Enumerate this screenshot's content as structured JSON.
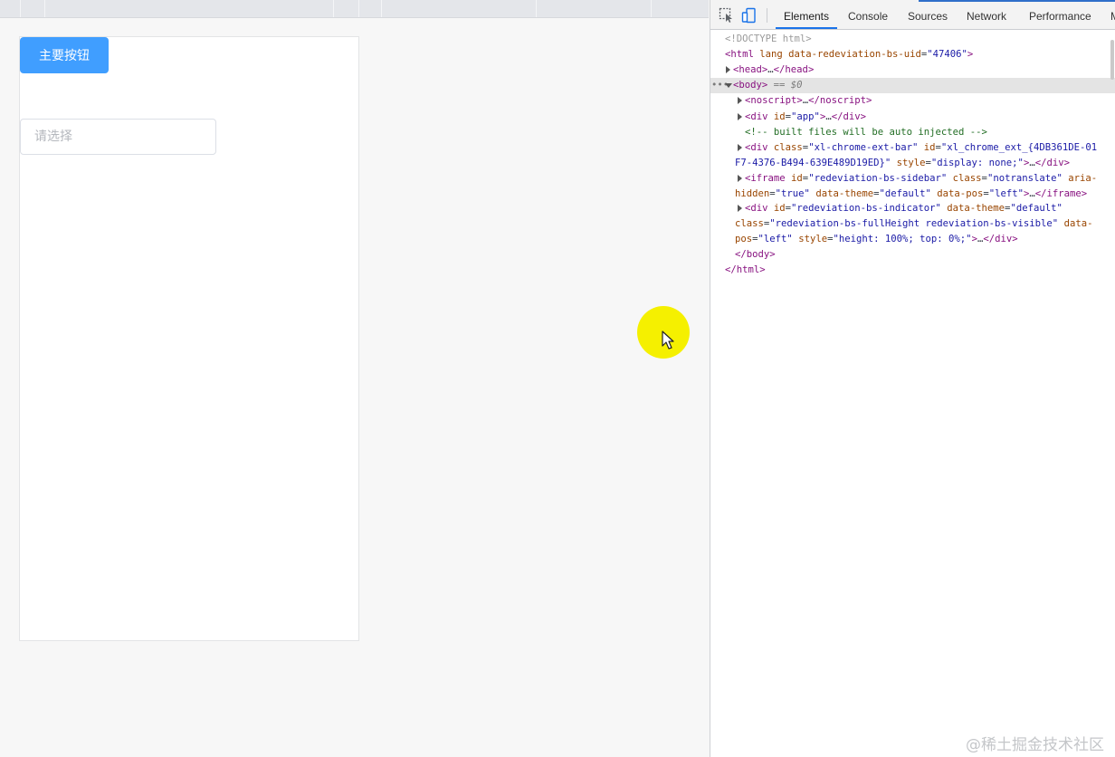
{
  "page": {
    "primary_button_label": "主要按钮",
    "select_placeholder": "请选择"
  },
  "devtools": {
    "tabs": [
      "Elements",
      "Console",
      "Sources",
      "Network",
      "Performance",
      "M"
    ],
    "active_tab": "Elements",
    "icons": [
      "inspect-element-icon",
      "device-toggle-icon"
    ],
    "dom": {
      "doctype": "<!DOCTYPE html>",
      "html_open": {
        "tag": "<html",
        "attr1": " lang",
        "attr2": " data-redeviation-bs-uid",
        "eq": "=",
        "val2": "\"47406\"",
        "close": ">"
      },
      "head": {
        "open": "<head>",
        "ellipsis": "…",
        "close": "</head>"
      },
      "body_line": {
        "dots": "•••",
        "open": "<body>",
        "eq": " == ",
        "ref": "$0"
      },
      "noscript": {
        "open": "<noscript>",
        "ellipsis": "…",
        "close": "</noscript>"
      },
      "div_app": {
        "open": "<div",
        "attr": " id",
        "eq": "=",
        "val": "\"app\"",
        "gt": ">",
        "ellipsis": "…",
        "close": "</div>"
      },
      "comment": "<!-- built files will be auto injected -->",
      "div_ext": {
        "open": "<div",
        "a1": " class",
        "v1": "\"xl-chrome-ext-bar\"",
        "a2": " id",
        "v2": "\"xl_chrome_ext_{4DB361DE-01",
        "v2b": "F7-4376-B494-639E489D19ED}\"",
        "a3": " style",
        "v3": "\"display: none;\"",
        "gt": ">",
        "ellipsis": "…",
        "close": "</div>"
      },
      "iframe": {
        "open": "<iframe",
        "a1": " id",
        "v1": "\"redeviation-bs-sidebar\"",
        "a2": " class",
        "v2": "\"notranslate\"",
        "a3": " aria-",
        "a3b": "hidden",
        "v3": "\"true\"",
        "a4": " data-theme",
        "v4": "\"default\"",
        "a5": " data-pos",
        "v5": "\"left\"",
        "gt": ">",
        "ellipsis": "…",
        "close": "</iframe>"
      },
      "div_indicator": {
        "open": "<div",
        "a1": " id",
        "v1": "\"redeviation-bs-indicator\"",
        "a2": " data-theme",
        "v2": "\"default\"",
        "a3": "class",
        "v3": "\"redeviation-bs-fullHeight redeviation-bs-visible\"",
        "a4": " data-",
        "a4b": "pos",
        "v4": "\"left\"",
        "a5": " style",
        "v5": "\"height: 100%; top: 0%;\"",
        "gt": ">",
        "ellipsis": "…",
        "close": "</div>"
      },
      "body_close": "</body>",
      "html_close": "</html>"
    }
  },
  "watermark": "@稀土掘金技术社区",
  "colors": {
    "primary": "#409eff",
    "cursor_highlight": "#f5f000",
    "devtools_active_tab": "#1a73e8"
  }
}
